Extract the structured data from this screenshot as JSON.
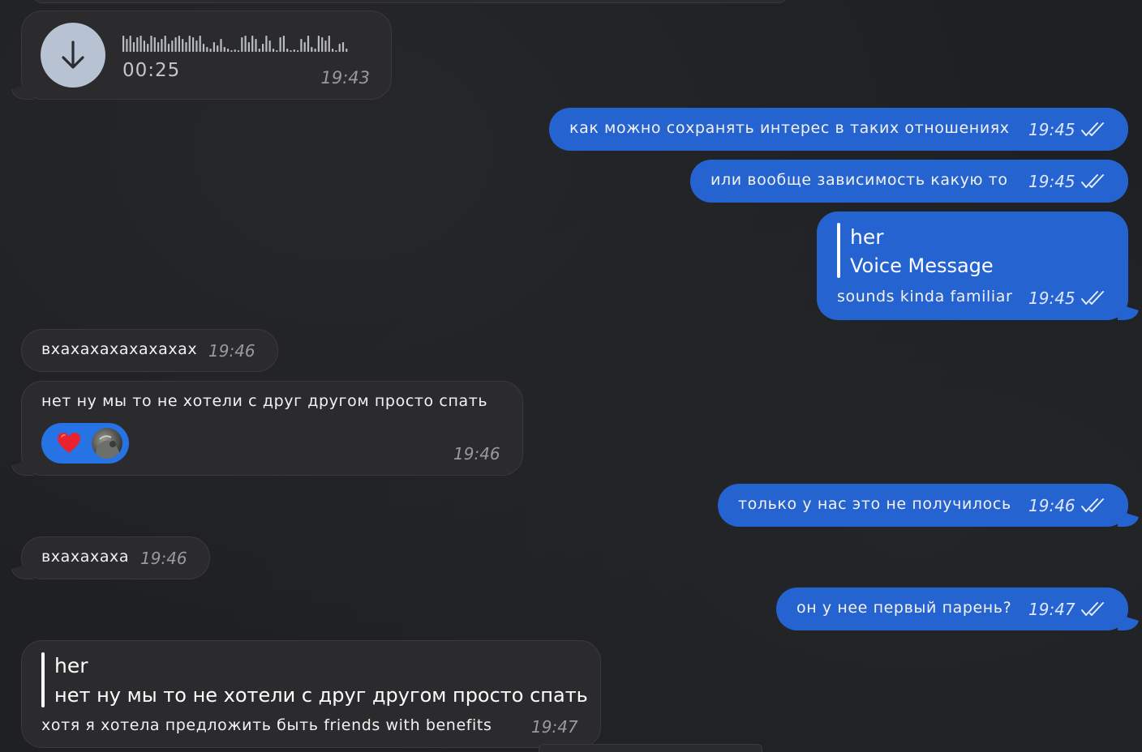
{
  "messages": {
    "voice": {
      "duration": "00:25",
      "time": "19:43",
      "icon": "download-arrow-icon"
    },
    "out1": {
      "text": "как можно сохранять интерес в таких отношениях",
      "time": "19:45",
      "status_icon": "double-check-icon"
    },
    "out2": {
      "text": "или вообще зависимость какую то",
      "time": "19:45",
      "status_icon": "double-check-icon"
    },
    "out3": {
      "reply_name": "her",
      "reply_text": "Voice Message",
      "text": "sounds kinda familiar",
      "time": "19:45",
      "status_icon": "double-check-icon"
    },
    "in1": {
      "text": "вхахахахахахахах",
      "time": "19:46"
    },
    "in2": {
      "text": "нет ну мы то не хотели с друг другом просто спать",
      "time": "19:46",
      "reaction_emoji": "❤️"
    },
    "out4": {
      "text": "только у нас это не получилось",
      "time": "19:46",
      "status_icon": "double-check-icon"
    },
    "in3": {
      "text": "вхахахаха",
      "time": "19:46"
    },
    "out5": {
      "text": "он у нее первый парень?",
      "time": "19:47",
      "status_icon": "double-check-icon"
    },
    "in4": {
      "reply_name": "her",
      "reply_text": "нет ну мы то не хотели с друг другом просто спать",
      "text": "хотя я хотела предложить быть friends with benefits",
      "time": "19:47"
    }
  },
  "colors": {
    "background": "#1e2023",
    "incoming_bubble": "#2b2b2d",
    "outgoing_bubble": "#2563d0",
    "reaction_pill": "#2673e6",
    "heart": "#e8222e"
  }
}
